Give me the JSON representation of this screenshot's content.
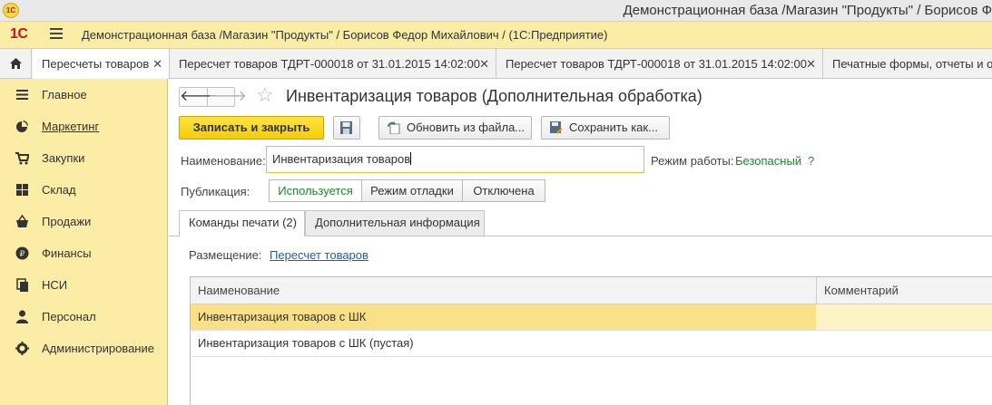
{
  "window": {
    "app_badge": "1С",
    "title": "Демонстрационная база /Магазин \"Продукты\" / Борисов Ф"
  },
  "appbar": {
    "logo": "1С",
    "app_name": "Демонстрационная база /Магазин \"Продукты\" / Борисов Федор Михайлович /  (1С:Предприятие)"
  },
  "tabs": [
    {
      "label": "Пересчеты товаров",
      "close": "✕"
    },
    {
      "label": "Пересчет товаров ТДРТ-000018 от 31.01.2015 14:02:00",
      "close": "✕"
    },
    {
      "label": "Пересчет товаров ТДРТ-000018 от 31.01.2015 14:02:00",
      "close": "✕"
    },
    {
      "label": "Печатные формы, отчеты и обработки",
      "close": ""
    }
  ],
  "sidebar": {
    "items": [
      {
        "label": "Главное",
        "icon": "menu-lines-icon"
      },
      {
        "label": "Маркетинг",
        "icon": "pie-chart-icon"
      },
      {
        "label": "Закупки",
        "icon": "cart-icon"
      },
      {
        "label": "Склад",
        "icon": "warehouse-grid-icon"
      },
      {
        "label": "Продажи",
        "icon": "basket-icon"
      },
      {
        "label": "Финансы",
        "icon": "ruble-coin-icon"
      },
      {
        "label": "НСИ",
        "icon": "documents-icon"
      },
      {
        "label": "Персонал",
        "icon": "person-icon"
      },
      {
        "label": "Администрирование",
        "icon": "gear-icon"
      }
    ]
  },
  "form": {
    "back": "🡐",
    "forward": "🡒",
    "star": "☆",
    "title": "Инвентаризация товаров (Дополнительная обработка)",
    "buttons": {
      "save_close": "Записать и закрыть",
      "update_from_file": "Обновить из файла...",
      "save_as": "Сохранить как..."
    },
    "name_label": "Наименование:",
    "name_value": "Инвентаризация товаров",
    "mode_label": "Режим работы:",
    "mode_value": "Безопасный",
    "mode_help": "?",
    "publication_label": "Публикация:",
    "publication_options": [
      "Используется",
      "Режим отладки",
      "Отключена"
    ],
    "publication_selected": "Используется",
    "tabs": [
      "Команды печати (2)",
      "Дополнительная информация"
    ],
    "placement_label": "Размещение:",
    "placement_link": "Пересчет товаров",
    "table": {
      "columns": [
        "Наименование",
        "Комментарий"
      ],
      "rows": [
        [
          "Инвентаризация товаров с ШК",
          ""
        ],
        [
          "Инвентаризация товаров с ШК (пустая)",
          ""
        ]
      ]
    }
  },
  "colors": {
    "accent_yellow": "#fbeca6",
    "primary_button": "#f5cd09",
    "selected_row": "#fbe08a",
    "mode_text": "#1a8a2c",
    "link": "#1f5ea8"
  }
}
